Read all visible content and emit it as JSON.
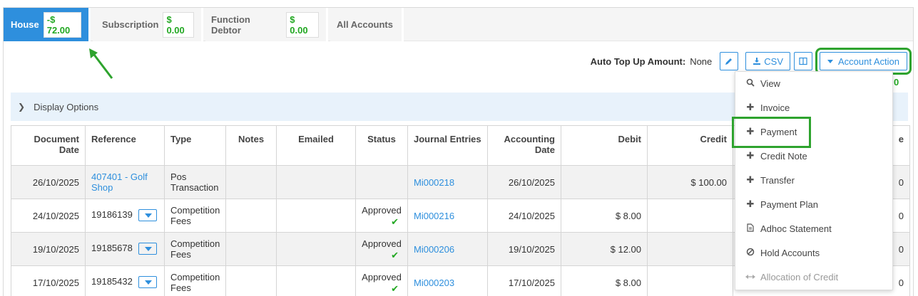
{
  "tabs": [
    {
      "label": "House",
      "amount": "-$ 72.00"
    },
    {
      "label": "Subscription",
      "amount": "$ 0.00"
    },
    {
      "label": "Function Debtor",
      "amount": "$ 0.00"
    },
    {
      "label": "All Accounts"
    }
  ],
  "toolbar": {
    "auto_top_up_label": "Auto Top Up Amount:",
    "auto_top_up_value": "None",
    "csv_label": "CSV",
    "account_action_label": "Account Action",
    "balance_fragment": "0"
  },
  "display_options": {
    "label": "Display Options"
  },
  "table": {
    "headers": [
      "Document Date",
      "Reference",
      "Type",
      "Notes",
      "Emailed",
      "Status",
      "Journal Entries",
      "Accounting Date",
      "Debit",
      "Credit",
      "e"
    ],
    "rows": [
      {
        "document_date": "26/10/2025",
        "reference": "407401 - Golf Shop",
        "type": "Pos Transaction",
        "status": "",
        "journal": "Mi000218",
        "accounting_date": "26/10/2025",
        "debit": "",
        "credit": "$ 100.00",
        "balance": "0"
      },
      {
        "document_date": "24/10/2025",
        "reference": "19186139",
        "type": "Competition Fees",
        "status": "Approved",
        "journal": "Mi000216",
        "accounting_date": "24/10/2025",
        "debit": "$ 8.00",
        "credit": "",
        "balance": "0"
      },
      {
        "document_date": "19/10/2025",
        "reference": "19185678",
        "type": "Competition Fees",
        "status": "Approved",
        "journal": "Mi000206",
        "accounting_date": "19/10/2025",
        "debit": "$ 12.00",
        "credit": "",
        "balance": "0"
      },
      {
        "document_date": "17/10/2025",
        "reference": "19185432",
        "type": "Competition Fees",
        "status": "Approved",
        "journal": "Mi000203",
        "accounting_date": "17/10/2025",
        "debit": "$ 8.00",
        "credit": "",
        "balance": "0"
      }
    ]
  },
  "menu": {
    "items": [
      {
        "label": "View",
        "icon": "search-icon"
      },
      {
        "label": "Invoice",
        "icon": "plus-icon"
      },
      {
        "label": "Payment",
        "icon": "plus-icon"
      },
      {
        "label": "Credit Note",
        "icon": "plus-icon"
      },
      {
        "label": "Transfer",
        "icon": "plus-icon"
      },
      {
        "label": "Payment Plan",
        "icon": "plus-icon"
      },
      {
        "label": "Adhoc Statement",
        "icon": "document-icon"
      },
      {
        "label": "Hold Accounts",
        "icon": "ban-icon"
      },
      {
        "label": "Allocation of Credit",
        "icon": "arrows-horizontal-icon",
        "disabled": true
      }
    ]
  },
  "colors": {
    "accent": "#2e8fdd",
    "highlight": "#2ea32e",
    "positive": "#22a822"
  }
}
